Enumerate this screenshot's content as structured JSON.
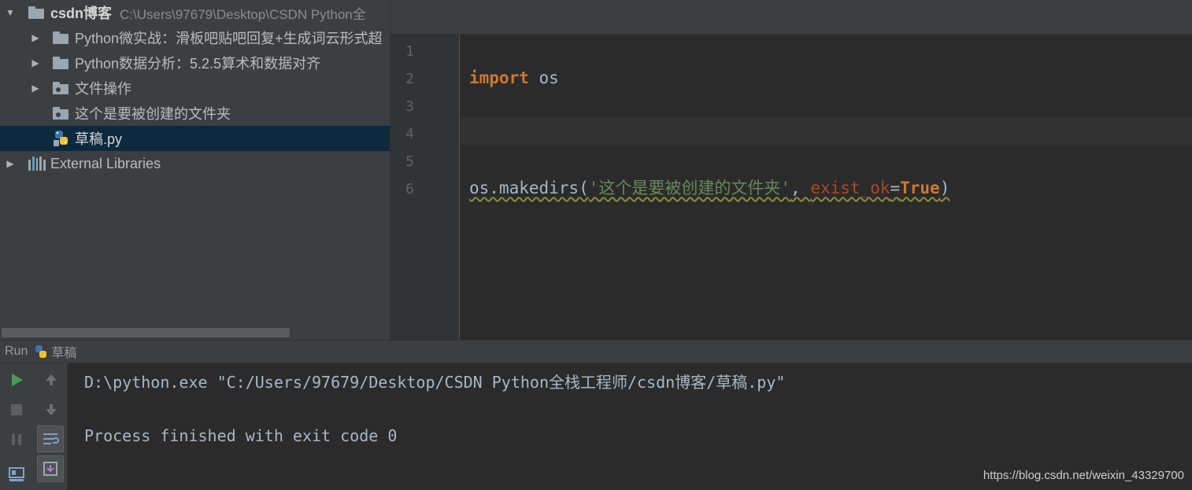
{
  "project": {
    "root": {
      "name": "csdn博客",
      "path": "C:\\Users\\97679\\Desktop\\CSDN Python全"
    },
    "items": [
      {
        "label": "Python微实战：滑板吧贴吧回复+生成词云形式超",
        "type": "folder",
        "expandable": true
      },
      {
        "label": "Python数据分析：5.2.5算术和数据对齐",
        "type": "folder",
        "expandable": true
      },
      {
        "label": "文件操作",
        "type": "folder",
        "expandable": true
      },
      {
        "label": "这个是要被创建的文件夹",
        "type": "folder",
        "expandable": false
      },
      {
        "label": "草稿.py",
        "type": "python-file",
        "selected": true
      }
    ],
    "external": "External Libraries"
  },
  "editor": {
    "line_numbers": [
      "1",
      "2",
      "3",
      "4",
      "5",
      "6"
    ],
    "code": {
      "import_kw": "import",
      "import_mod": " os",
      "call": "os.makedirs(",
      "arg_str": "'这个是要被创建的文件夹'",
      "comma": ", ",
      "param": "exist_ok",
      "eq": "=",
      "true_kw": "True",
      "close": ")"
    }
  },
  "run": {
    "label": "Run",
    "file": "草稿",
    "output": [
      "D:\\python.exe \"C:/Users/97679/Desktop/CSDN Python全栈工程师/csdn博客/草稿.py\"",
      "Process finished with exit code 0"
    ]
  },
  "watermark": "https://blog.csdn.net/weixin_43329700",
  "colors": {
    "keyword": "#cc7832",
    "string": "#6a8759",
    "param": "#aa4926",
    "run_green": "#499c54"
  }
}
